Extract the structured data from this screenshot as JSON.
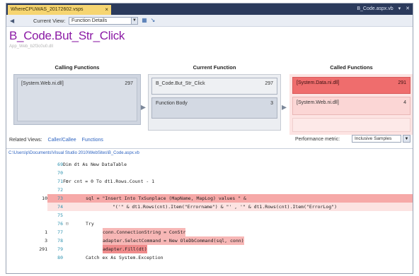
{
  "tab": {
    "title": "WhereCPUWAS_20172602.vsps",
    "close": "×",
    "right_title": "B_Code.aspx.vb",
    "right_controls": [
      "▾",
      "✕"
    ]
  },
  "toolbar": {
    "back_icon": "back-arrow-icon",
    "current_view_label": "Current View:",
    "current_view_value": "Function Details",
    "icons": [
      "export-icon",
      "settings-icon"
    ]
  },
  "function": {
    "name": "B_Code.But_Str_Click",
    "subtitle": "App_Web_b2f3c0u0.dll"
  },
  "panels": {
    "calling_header": "Calling Functions",
    "current_header": "Current Function",
    "called_header": "Called Functions",
    "calling": [
      {
        "name": "[System.Web.ni.dll]",
        "value": "297"
      }
    ],
    "current": [
      {
        "name": "B_Code.But_Str_Click",
        "value": "297"
      },
      {
        "name": "Function Body",
        "value": "3"
      }
    ],
    "called": [
      {
        "name": "[System.Data.ni.dll]",
        "value": "291"
      },
      {
        "name": "[System.Web.ni.dll]",
        "value": "4"
      },
      {
        "name": "",
        "value": ""
      }
    ]
  },
  "related": {
    "label": "Related Views:",
    "links": [
      "Caller/Callee",
      "Functions"
    ],
    "perf_label": "Performance metric:",
    "perf_value": "Inclusive Samples"
  },
  "editor": {
    "file_path": "C:\\Users\\p\\Documents\\Visual Studio 2010\\WebSites\\B_Code.aspx.vb",
    "lines": [
      {
        "count": "",
        "num": "69",
        "fold": "",
        "code": "Dim dt As New DataTable",
        "hl": "none"
      },
      {
        "count": "",
        "num": "70",
        "fold": "",
        "code": "",
        "hl": "none"
      },
      {
        "count": "",
        "num": "71",
        "fold": "⊟",
        "code": "For cnt = 0 To dt1.Rows.Count - 1",
        "hl": "none"
      },
      {
        "count": "",
        "num": "72",
        "fold": "",
        "code": "",
        "hl": "none"
      },
      {
        "count": "10",
        "num": "73",
        "fold": "",
        "code": "sql = \"Insert Into TxSunplace (MapName, MapLog) values \" &",
        "hl": "strong"
      },
      {
        "count": "",
        "num": "74",
        "fold": "",
        "code": "\"('\" & dt1.Rows(cnt).Item(\"Errorname\") & \"' , '\" & dt1.Rows(cnt).Item(\"ErrorLog\")",
        "hl": "light"
      },
      {
        "count": "",
        "num": "75",
        "fold": "",
        "code": "",
        "hl": "none"
      },
      {
        "count": "",
        "num": "76",
        "fold": "⊟",
        "code": "Try",
        "hl": "none"
      },
      {
        "count": "1",
        "num": "77",
        "fold": "",
        "code": "conn.ConnectionString = ConStr",
        "hl": "medium"
      },
      {
        "count": "3",
        "num": "78",
        "fold": "",
        "code": "adapter.SelectCommand = New OleDbCommand(sql, conn)",
        "hl": "medium"
      },
      {
        "count": "291",
        "num": "79",
        "fold": "",
        "code": "adapter.Fill(dt)",
        "hl": "strongtext"
      },
      {
        "count": "",
        "num": "80",
        "fold": "",
        "code": "Catch ex As System.Exception",
        "hl": "none"
      }
    ]
  }
}
